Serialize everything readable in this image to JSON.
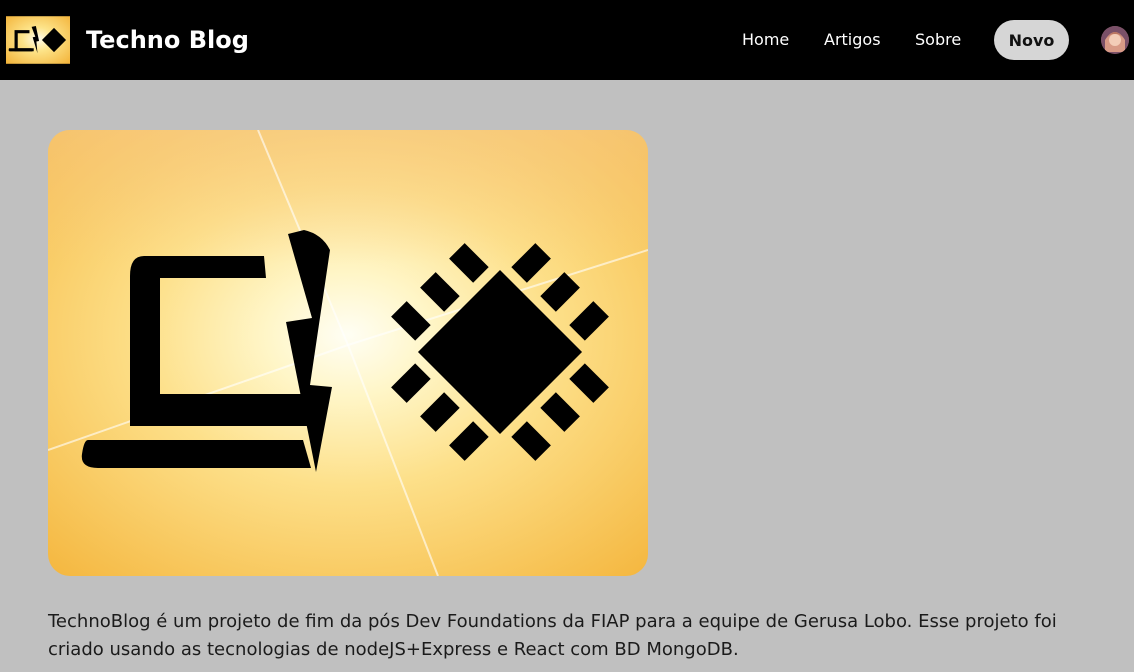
{
  "header": {
    "brand": "Techno Blog",
    "logo_icon": "laptop-chip-logo-icon",
    "nav": {
      "home": "Home",
      "articles": "Artigos",
      "about": "Sobre"
    },
    "new_button": "Novo",
    "avatar_icon": "user-avatar-icon"
  },
  "main": {
    "hero_image_icon": "laptop-lightning-chip-illustration",
    "description": "TechnoBlog é um projeto de fim da pós Dev Foundations da FIAP para a equipe de Gerusa Lobo. Esse projeto foi criado usando as tecnologias de nodeJS+Express e React com BD MongoDB."
  },
  "colors": {
    "header_bg": "#000000",
    "page_bg": "#c0c0c0",
    "button_bg": "#d6d6d6",
    "hero_light": "#fffbe6",
    "hero_dark": "#f5b93a"
  }
}
